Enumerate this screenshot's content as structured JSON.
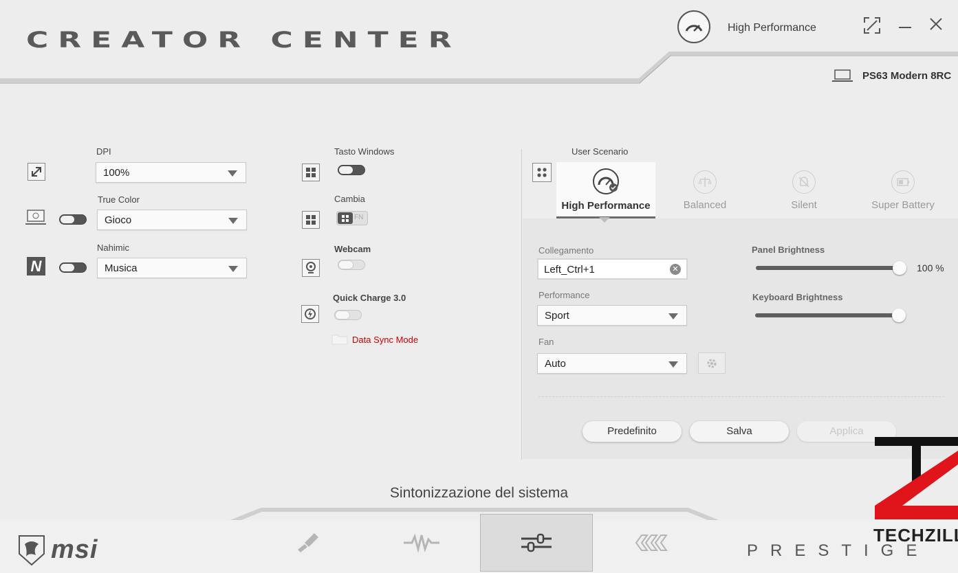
{
  "app": {
    "title": "CREATOR CENTER",
    "mode": "High Performance",
    "device": "PS63 Modern 8RC"
  },
  "left": {
    "dpi": {
      "label": "DPI",
      "value": "100%"
    },
    "true_color": {
      "label": "True Color",
      "value": "Gioco"
    },
    "nahimic": {
      "label": "Nahimic",
      "value": "Musica"
    }
  },
  "middle": {
    "tasto_windows": {
      "label": "Tasto Windows"
    },
    "cambia": {
      "label": "Cambia",
      "fn": "FN"
    },
    "webcam": {
      "label": "Webcam"
    },
    "quick_charge": {
      "label": "Quick Charge 3.0"
    },
    "data_sync": {
      "label": "Data Sync Mode",
      "color": "#cc0000"
    }
  },
  "scenario": {
    "label": "User Scenario",
    "tabs": [
      {
        "label": "High Performance",
        "active": true
      },
      {
        "label": "Balanced"
      },
      {
        "label": "Silent"
      },
      {
        "label": "Super Battery"
      }
    ],
    "collegamento": {
      "label": "Collegamento",
      "value": "Left_Ctrl+1"
    },
    "performance": {
      "label": "Performance",
      "value": "Sport"
    },
    "fan": {
      "label": "Fan",
      "value": "Auto"
    },
    "panel_brightness": {
      "label": "Panel Brightness",
      "value": 100,
      "display": "100 %"
    },
    "keyboard_brightness": {
      "label": "Keyboard Brightness",
      "value": 100
    },
    "buttons": {
      "default": "Predefinito",
      "save": "Salva",
      "apply": "Applica"
    }
  },
  "section_title": "Sintonizzazione del sistema",
  "brand": {
    "msi": "msi",
    "prestige": "PRESTIGE",
    "watermark": "TECHZILLA.IT"
  }
}
